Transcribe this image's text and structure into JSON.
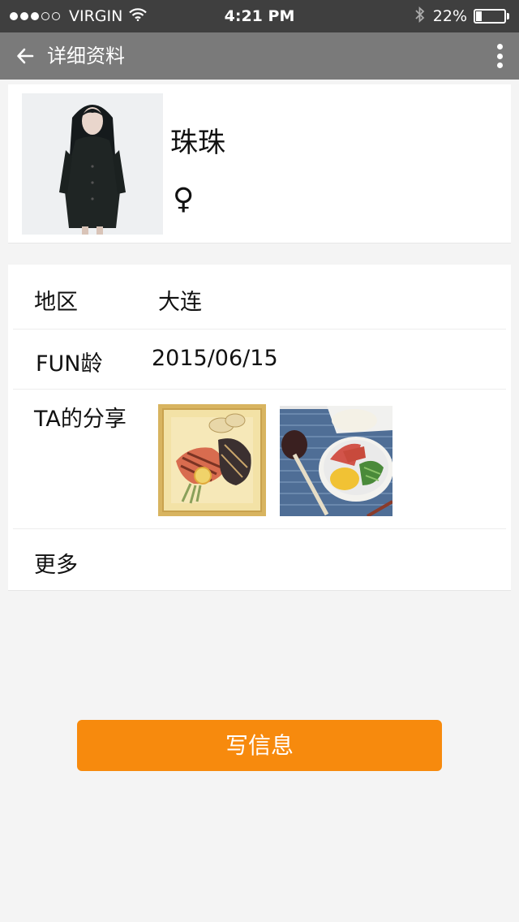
{
  "status_bar": {
    "carrier": "VIRGIN",
    "time": "4:21 PM",
    "battery_text": "22%",
    "battery_level": 0.22,
    "signal_bars_filled": 3,
    "signal_bars_total": 5
  },
  "nav": {
    "title": "详细资料",
    "back_icon": "back-arrow-icon",
    "more_icon": "more-vertical-icon"
  },
  "profile": {
    "name": "珠珠",
    "gender_symbol": "♀"
  },
  "info": {
    "region_label": "地区",
    "region_value": "大连",
    "fun_age_label": "FUN龄",
    "fun_age_value": "2015/06/15",
    "shares_label": "TA的分享",
    "more_label": "更多"
  },
  "actions": {
    "send_message": "写信息"
  },
  "colors": {
    "status_bar_bg": "#3f3f3f",
    "nav_bar_bg": "#7a7a7a",
    "accent": "#f78a0d",
    "page_bg": "#f4f4f4"
  }
}
